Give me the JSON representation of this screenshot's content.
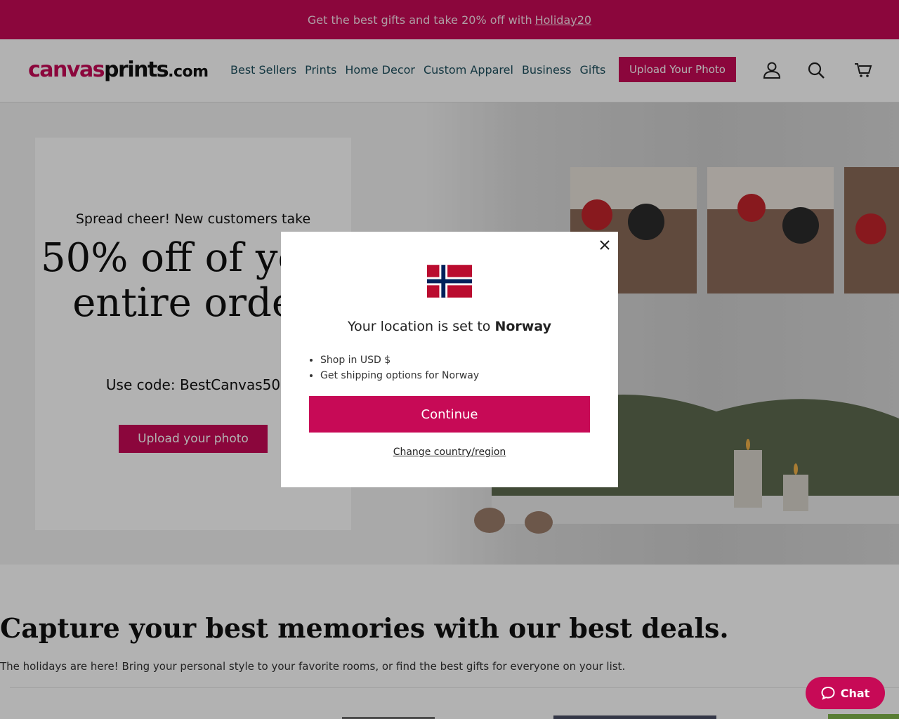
{
  "announcement": {
    "text": "Get the best gifts and take 20% off with",
    "code_link": "Holiday20"
  },
  "header": {
    "logo": {
      "part1": "canvas",
      "part2": "prints",
      "part3": ".com"
    },
    "nav": [
      "Best Sellers",
      "Prints",
      "Home Decor",
      "Custom Apparel",
      "Business",
      "Gifts"
    ],
    "upload_label": "Upload Your Photo",
    "icons": [
      "account-icon",
      "search-icon",
      "cart-icon"
    ]
  },
  "hero": {
    "pre": "Spread cheer! New customers take",
    "headline": "50% off of your entire order",
    "code": "Use code: BestCanvas50",
    "button": "Upload your photo"
  },
  "section": {
    "title": "Capture your best memories with our best deals.",
    "subtitle": "The holidays are here! Bring your personal style to your favorite rooms, or find the best gifts for everyone on your list."
  },
  "modal": {
    "location_prefix": "Your location is set to",
    "country": "Norway",
    "bullets": [
      "Shop in USD $",
      "Get shipping options for Norway"
    ],
    "continue_label": "Continue",
    "change_label": "Change country/region"
  },
  "chat": {
    "label": "Chat"
  },
  "colors": {
    "brand": "#c70a56",
    "nav_text": "#1d4f5e",
    "flag_red": "#ba0c2f",
    "flag_blue": "#00205b"
  }
}
